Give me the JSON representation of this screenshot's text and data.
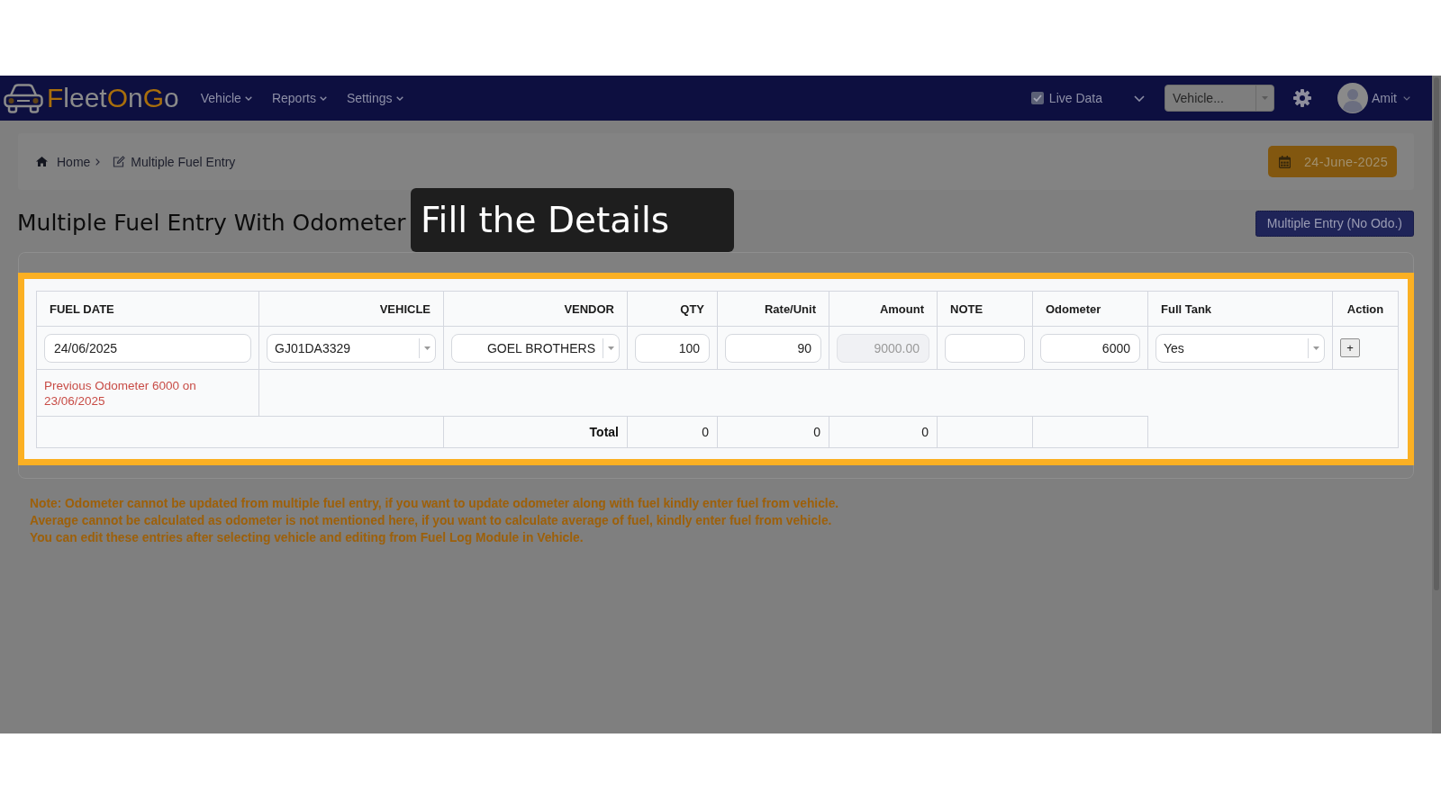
{
  "navbar": {
    "logo_parts": [
      {
        "text": "F",
        "accent": true
      },
      {
        "text": "leet",
        "accent": false
      },
      {
        "text": "O",
        "accent": true
      },
      {
        "text": "n",
        "accent": false
      },
      {
        "text": "G",
        "accent": true
      },
      {
        "text": "o",
        "accent": false
      }
    ],
    "menu": [
      "Vehicle",
      "Reports",
      "Settings"
    ],
    "live_data": {
      "label": "Live Data",
      "checked": true
    },
    "vehicle_select": {
      "placeholder": "Vehicle..."
    },
    "user": {
      "name": "Amit"
    }
  },
  "breadcrumb": [
    {
      "kind": "home",
      "label": "Home"
    },
    {
      "kind": "edit",
      "label": "Multiple Fuel Entry"
    }
  ],
  "date_button": {
    "label": "24-June-2025"
  },
  "page_title": "Multiple Fuel Entry With Odometer",
  "mode_button": {
    "label": "Multiple Entry (No Odo.)"
  },
  "tooltip": {
    "text": "Fill the Details"
  },
  "table": {
    "columns": [
      "FUEL DATE",
      "VEHICLE",
      "VENDOR",
      "QTY",
      "Rate/Unit",
      "Amount",
      "NOTE",
      "Odometer",
      "Full Tank",
      "Action"
    ],
    "entry_row": [
      {
        "kind": "input",
        "value": "24/06/2025",
        "disabled": false
      },
      {
        "kind": "select",
        "value": "GJ01DA3329",
        "disabled": false
      },
      {
        "kind": "select",
        "value": "GOEL BROTHERS",
        "disabled": false
      },
      {
        "kind": "input",
        "value": "100",
        "disabled": false
      },
      {
        "kind": "input",
        "value": "90",
        "disabled": false
      },
      {
        "kind": "input",
        "value": "9000.00",
        "disabled": true
      },
      {
        "kind": "input",
        "disabled": false
      },
      {
        "kind": "input",
        "value": "6000",
        "disabled": false
      },
      {
        "kind": "select",
        "value": "Yes",
        "disabled": false
      },
      {
        "kind": "button",
        "label": "+",
        "disabled": false
      }
    ],
    "message": "Previous Odometer 6000 on 23/06/2025",
    "total_row": {
      "label": "Total",
      "qty": "0",
      "rate_unit": "0",
      "amount": "0"
    }
  },
  "notes": [
    "Note: Odometer cannot be updated from multiple fuel entry, if you want to update odometer along with fuel kindly enter fuel from vehicle.",
    "Average cannot be calculated as odometer is not mentioned here, if you want to calculate average of fuel, kindly enter fuel from vehicle.",
    "You can edit these entries after selecting vehicle and editing from Fuel Log Module in Vehicle."
  ]
}
